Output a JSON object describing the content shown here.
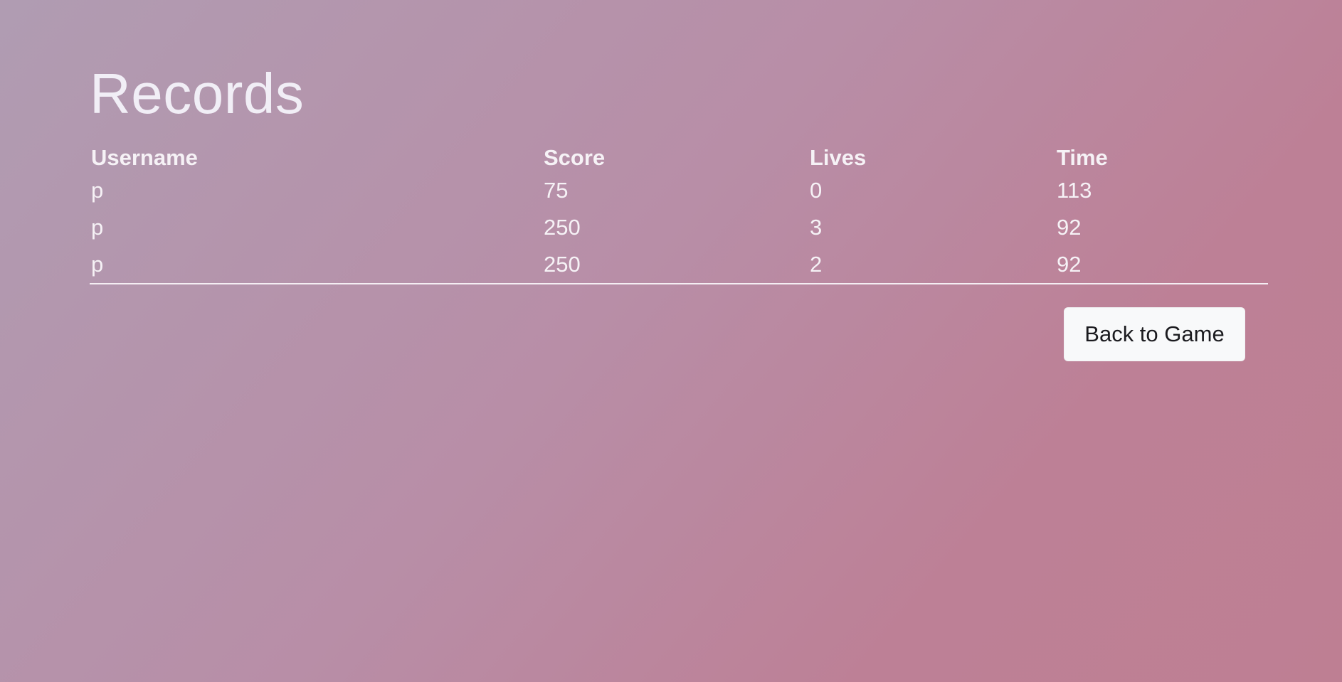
{
  "page": {
    "title": "Records"
  },
  "table": {
    "headers": [
      "Username",
      "Score",
      "Lives",
      "Time"
    ],
    "rows": [
      [
        "p",
        "75",
        "0",
        "113"
      ],
      [
        "p",
        "250",
        "3",
        "92"
      ],
      [
        "p",
        "250",
        "2",
        "92"
      ]
    ]
  },
  "actions": {
    "back_label": "Back to Game"
  },
  "colors": {
    "background_start": "#b09cb2",
    "background_end": "#be7f93",
    "text": "#f3f0f5",
    "button_bg": "#f8f9fa",
    "button_text": "#1b1b1f"
  }
}
